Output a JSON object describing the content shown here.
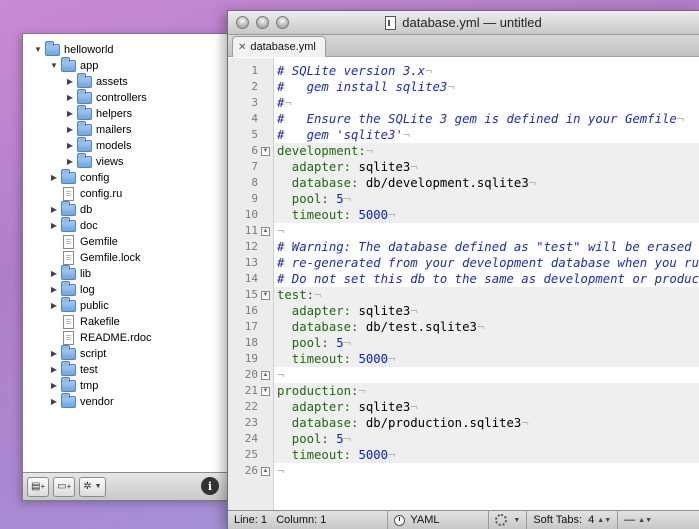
{
  "drawer": {
    "tree": [
      {
        "label": "helloworld",
        "type": "folder",
        "depth": 0,
        "expanded": true
      },
      {
        "label": "app",
        "type": "folder",
        "depth": 1,
        "expanded": true
      },
      {
        "label": "assets",
        "type": "folder",
        "depth": 2,
        "expanded": false
      },
      {
        "label": "controllers",
        "type": "folder",
        "depth": 2,
        "expanded": false
      },
      {
        "label": "helpers",
        "type": "folder",
        "depth": 2,
        "expanded": false
      },
      {
        "label": "mailers",
        "type": "folder",
        "depth": 2,
        "expanded": false
      },
      {
        "label": "models",
        "type": "folder",
        "depth": 2,
        "expanded": false
      },
      {
        "label": "views",
        "type": "folder",
        "depth": 2,
        "expanded": false
      },
      {
        "label": "config",
        "type": "folder",
        "depth": 1,
        "expanded": false
      },
      {
        "label": "config.ru",
        "type": "file",
        "depth": 1
      },
      {
        "label": "db",
        "type": "folder",
        "depth": 1,
        "expanded": false
      },
      {
        "label": "doc",
        "type": "folder",
        "depth": 1,
        "expanded": false
      },
      {
        "label": "Gemfile",
        "type": "file",
        "depth": 1
      },
      {
        "label": "Gemfile.lock",
        "type": "file",
        "depth": 1
      },
      {
        "label": "lib",
        "type": "folder",
        "depth": 1,
        "expanded": false
      },
      {
        "label": "log",
        "type": "folder",
        "depth": 1,
        "expanded": false
      },
      {
        "label": "public",
        "type": "folder",
        "depth": 1,
        "expanded": false
      },
      {
        "label": "Rakefile",
        "type": "file",
        "depth": 1
      },
      {
        "label": "README.rdoc",
        "type": "file",
        "depth": 1
      },
      {
        "label": "script",
        "type": "folder",
        "depth": 1,
        "expanded": false
      },
      {
        "label": "test",
        "type": "folder",
        "depth": 1,
        "expanded": false
      },
      {
        "label": "tmp",
        "type": "folder",
        "depth": 1,
        "expanded": false
      },
      {
        "label": "vendor",
        "type": "folder",
        "depth": 1,
        "expanded": false
      }
    ],
    "buttons": {
      "new_file_icon": "new-file-icon",
      "new_folder_icon": "new-folder-icon",
      "action_icon": "gear-icon",
      "info_label": "i"
    }
  },
  "window": {
    "title": "database.yml — untitled",
    "tab_label": "database.yml",
    "tab_close": "✕"
  },
  "editor": {
    "lines": [
      {
        "n": "1",
        "parts": [
          {
            "t": "# SQLite version 3.x",
            "c": "c"
          },
          {
            "t": "¬",
            "c": "inv"
          }
        ]
      },
      {
        "n": "2",
        "parts": [
          {
            "t": "#   gem install sqlite3",
            "c": "c"
          },
          {
            "t": "¬",
            "c": "inv"
          }
        ]
      },
      {
        "n": "3",
        "parts": [
          {
            "t": "#",
            "c": "c"
          },
          {
            "t": "¬",
            "c": "inv"
          }
        ]
      },
      {
        "n": "4",
        "parts": [
          {
            "t": "#   Ensure the SQLite 3 gem is defined in your Gemfile",
            "c": "c"
          },
          {
            "t": "¬",
            "c": "inv"
          }
        ]
      },
      {
        "n": "5",
        "parts": [
          {
            "t": "#   gem 'sqlite3'",
            "c": "c"
          },
          {
            "t": "¬",
            "c": "inv"
          }
        ]
      },
      {
        "n": "6",
        "fold": "open",
        "hl": true,
        "parts": [
          {
            "t": "development:",
            "c": "k"
          },
          {
            "t": "¬",
            "c": "inv"
          }
        ]
      },
      {
        "n": "7",
        "hl": true,
        "parts": [
          {
            "t": "  adapter: ",
            "c": "k"
          },
          {
            "t": "sqlite3",
            "c": "s"
          },
          {
            "t": "¬",
            "c": "inv"
          }
        ]
      },
      {
        "n": "8",
        "hl": true,
        "parts": [
          {
            "t": "  database: ",
            "c": "k"
          },
          {
            "t": "db/development.sqlite3",
            "c": "s"
          },
          {
            "t": "¬",
            "c": "inv"
          }
        ]
      },
      {
        "n": "9",
        "hl": true,
        "parts": [
          {
            "t": "  pool: ",
            "c": "k"
          },
          {
            "t": "5",
            "c": "n"
          },
          {
            "t": "¬",
            "c": "inv"
          }
        ]
      },
      {
        "n": "10",
        "hl": true,
        "parts": [
          {
            "t": "  timeout: ",
            "c": "k"
          },
          {
            "t": "5000",
            "c": "n"
          },
          {
            "t": "¬",
            "c": "inv"
          }
        ]
      },
      {
        "n": "11",
        "fold": "close",
        "parts": [
          {
            "t": "¬",
            "c": "inv"
          }
        ]
      },
      {
        "n": "12",
        "parts": [
          {
            "t": "# Warning: The database defined as \"test\" will be erased and",
            "c": "c"
          }
        ]
      },
      {
        "n": "13",
        "parts": [
          {
            "t": "# re-generated from your development database when you run",
            "c": "c"
          }
        ]
      },
      {
        "n": "14",
        "parts": [
          {
            "t": "# Do not set this db to the same as development or production",
            "c": "c"
          }
        ]
      },
      {
        "n": "15",
        "fold": "open",
        "hl": true,
        "parts": [
          {
            "t": "test:",
            "c": "k"
          },
          {
            "t": "¬",
            "c": "inv"
          }
        ]
      },
      {
        "n": "16",
        "hl": true,
        "parts": [
          {
            "t": "  adapter: ",
            "c": "k"
          },
          {
            "t": "sqlite3",
            "c": "s"
          },
          {
            "t": "¬",
            "c": "inv"
          }
        ]
      },
      {
        "n": "17",
        "hl": true,
        "parts": [
          {
            "t": "  database: ",
            "c": "k"
          },
          {
            "t": "db/test.sqlite3",
            "c": "s"
          },
          {
            "t": "¬",
            "c": "inv"
          }
        ]
      },
      {
        "n": "18",
        "hl": true,
        "parts": [
          {
            "t": "  pool: ",
            "c": "k"
          },
          {
            "t": "5",
            "c": "n"
          },
          {
            "t": "¬",
            "c": "inv"
          }
        ]
      },
      {
        "n": "19",
        "hl": true,
        "parts": [
          {
            "t": "  timeout: ",
            "c": "k"
          },
          {
            "t": "5000",
            "c": "n"
          },
          {
            "t": "¬",
            "c": "inv"
          }
        ]
      },
      {
        "n": "20",
        "fold": "close",
        "parts": [
          {
            "t": "¬",
            "c": "inv"
          }
        ]
      },
      {
        "n": "21",
        "fold": "open",
        "hl": true,
        "parts": [
          {
            "t": "production:",
            "c": "k"
          },
          {
            "t": "¬",
            "c": "inv"
          }
        ]
      },
      {
        "n": "22",
        "hl": true,
        "parts": [
          {
            "t": "  adapter: ",
            "c": "k"
          },
          {
            "t": "sqlite3",
            "c": "s"
          },
          {
            "t": "¬",
            "c": "inv"
          }
        ]
      },
      {
        "n": "23",
        "hl": true,
        "parts": [
          {
            "t": "  database: ",
            "c": "k"
          },
          {
            "t": "db/production.sqlite3",
            "c": "s"
          },
          {
            "t": "¬",
            "c": "inv"
          }
        ]
      },
      {
        "n": "24",
        "hl": true,
        "parts": [
          {
            "t": "  pool: ",
            "c": "k"
          },
          {
            "t": "5",
            "c": "n"
          },
          {
            "t": "¬",
            "c": "inv"
          }
        ]
      },
      {
        "n": "25",
        "hl": true,
        "parts": [
          {
            "t": "  timeout: ",
            "c": "k"
          },
          {
            "t": "5000",
            "c": "n"
          },
          {
            "t": "¬",
            "c": "inv"
          }
        ]
      },
      {
        "n": "26",
        "fold": "close",
        "parts": [
          {
            "t": "¬",
            "c": "inv"
          }
        ]
      }
    ]
  },
  "statusbar": {
    "line_label": "Line:",
    "line_value": "1",
    "column_label": "Column:",
    "column_value": "1",
    "language": "YAML",
    "soft_tabs_label": "Soft Tabs:",
    "soft_tabs_value": "4",
    "symbol_value": "—"
  },
  "colors": {
    "comment": "#1a2fb8",
    "key": "#1f6a12",
    "number": "#0028d0",
    "highlight_row": "#efefef"
  }
}
